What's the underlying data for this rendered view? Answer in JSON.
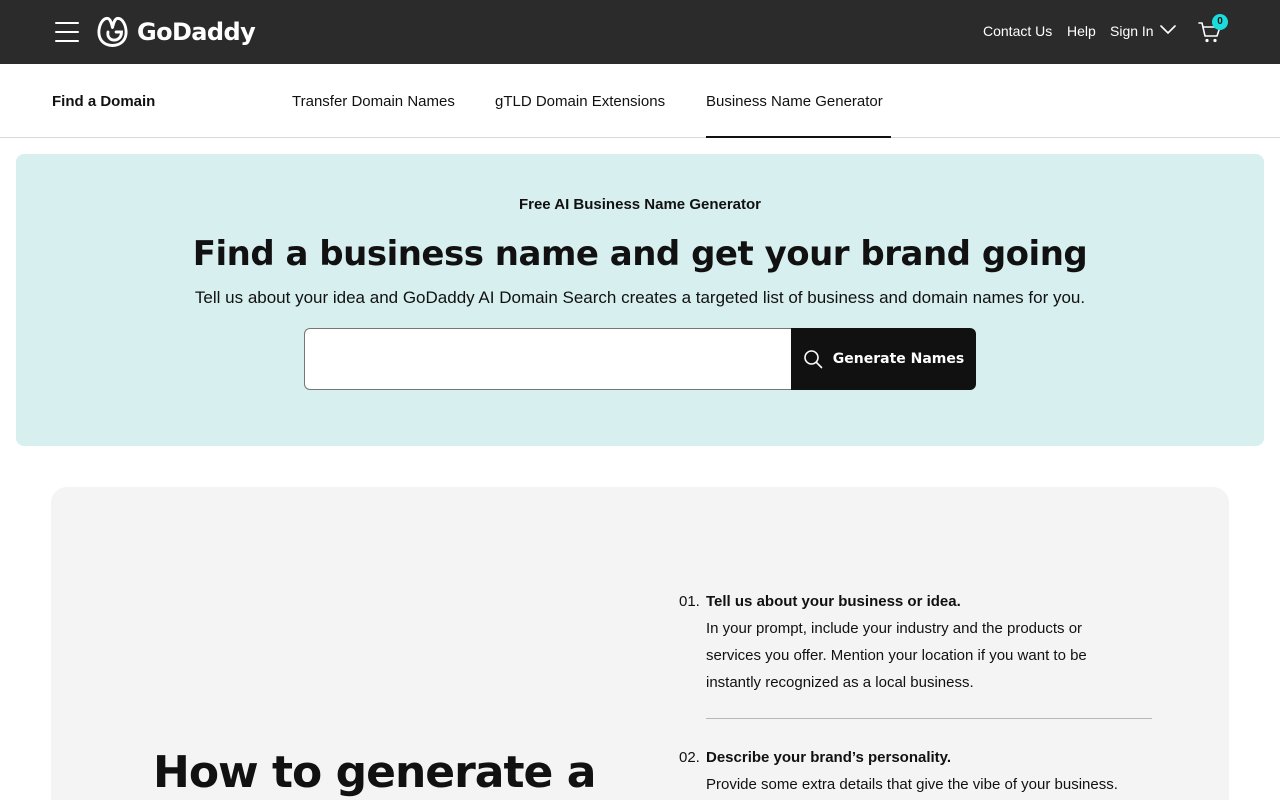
{
  "header": {
    "logo_text": "GoDaddy",
    "contact_label": "Contact Us",
    "help_label": "Help",
    "signin_label": "Sign In",
    "cart_count": "0",
    "badge_color": "#1bdbdb",
    "background_color": "#2b2b2b"
  },
  "subnav": {
    "title": "Find a Domain",
    "tabs": [
      {
        "label": "Transfer Domain Names",
        "active": false
      },
      {
        "label": "gTLD Domain Extensions",
        "active": false
      },
      {
        "label": "Business Name Generator",
        "active": true
      }
    ]
  },
  "hero": {
    "eyebrow": "Free AI Business Name Generator",
    "title": "Find a business name and get your brand going",
    "subtitle": "Tell us about your idea and GoDaddy AI Domain Search creates a targeted list of business and domain names for you.",
    "search_value": "",
    "button_label": "Generate Names",
    "background_color": "#d8eff0"
  },
  "howto": {
    "title": "How to generate a",
    "steps": [
      {
        "number": "01.",
        "heading": "Tell us about your business or idea.",
        "body": "In your prompt, include your industry and the products or services you offer. Mention your location if you want to be instantly recognized as a local business."
      },
      {
        "number": "02.",
        "heading": "Describe your brand’s personality.",
        "body": "Provide some extra details that give the vibe of your business."
      }
    ]
  }
}
